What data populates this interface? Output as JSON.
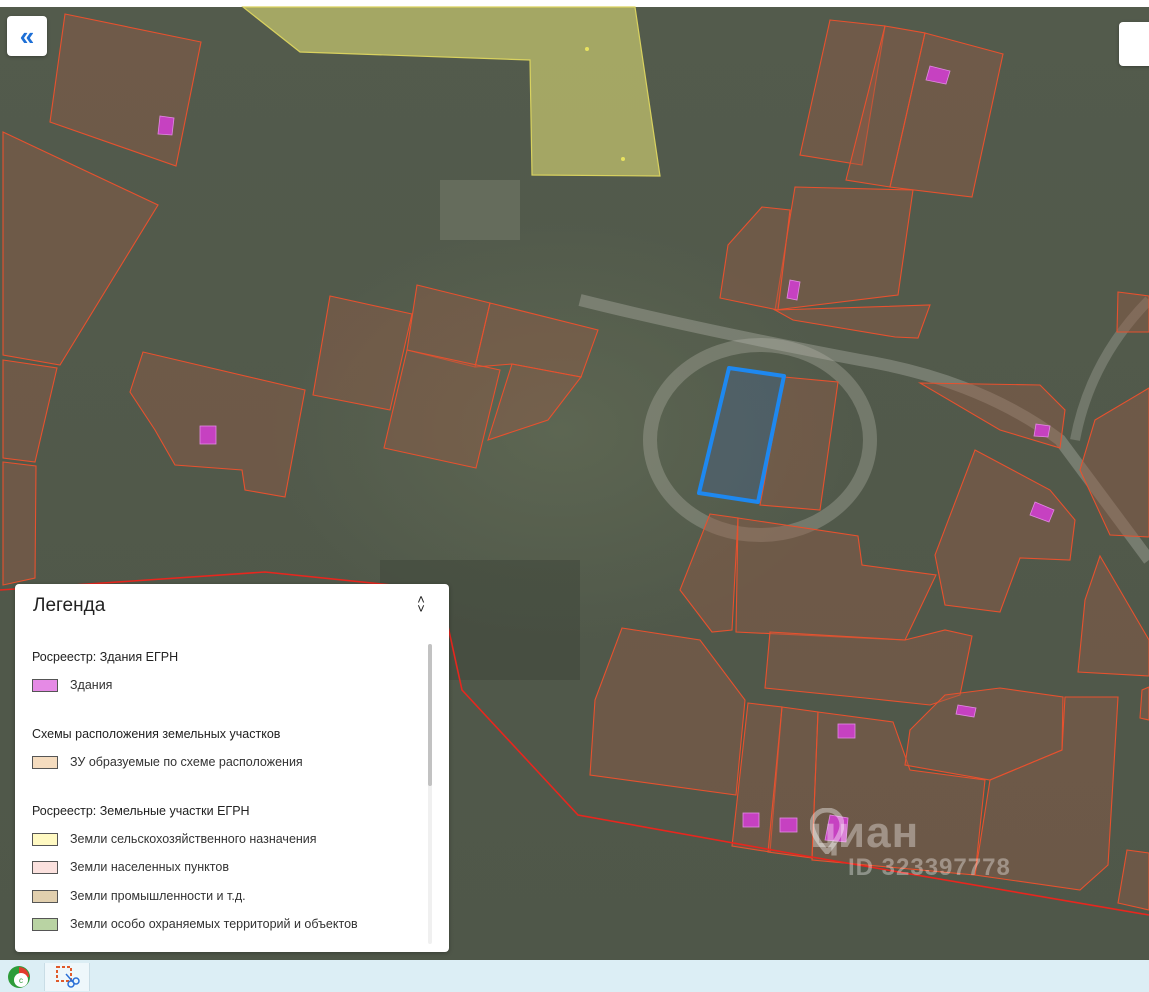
{
  "colors": {
    "parcel_stroke": "#e7512e",
    "parcel_fill": "rgba(150,90,70,0.42)",
    "building_fill": "#c641c1",
    "agri_fill": "rgba(232,230,120,0.55)",
    "agri_stroke": "#d9d25f",
    "selected_stroke": "#1e88f0",
    "selected_fill": "rgba(70,100,150,0.35)",
    "boundary_line": "#e8261e"
  },
  "map": {
    "collapse_icon": "double-chevron-left-icon",
    "watermark": {
      "brand": "циан",
      "id": "ID 323397778"
    }
  },
  "legend": {
    "title": "Легенда",
    "toggle_icon": "collapse-chevrons-icon",
    "sections": [
      {
        "title": "Росреестр: Здания ЕГРН",
        "items": [
          {
            "label": "Здания",
            "color": "#e58ae5"
          }
        ]
      },
      {
        "title": "Схемы расположения земельных участков",
        "items": [
          {
            "label": "ЗУ образуемые по схеме расположения",
            "color": "#f5dcbf"
          }
        ]
      },
      {
        "title": "Росреестр: Земельные участки ЕГРН",
        "items": [
          {
            "label": "Земли сельскохозяйственного назначения",
            "color": "#fff9c2"
          },
          {
            "label": "Земли населенных пунктов",
            "color": "#fbe1de"
          },
          {
            "label": "Земли промышленности и т.д.",
            "color": "#e1cfae"
          },
          {
            "label": "Земли особо охраняемых территорий и объектов",
            "color": "#b9d3a3"
          }
        ]
      }
    ]
  },
  "taskbar": {
    "apps": [
      {
        "icon": "ccleaner-icon"
      },
      {
        "icon": "snipping-tool-icon"
      }
    ]
  }
}
